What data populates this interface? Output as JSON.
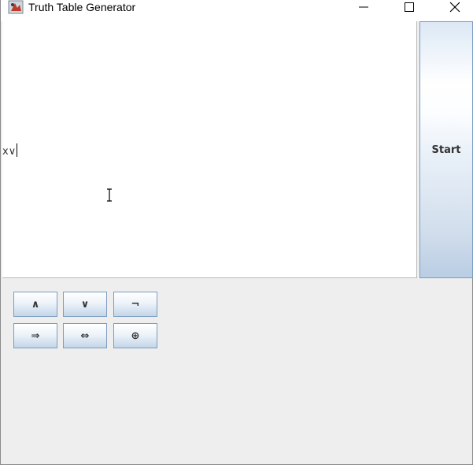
{
  "window": {
    "title": "Truth Table Generator",
    "icons": {
      "app": "java-app-icon",
      "minimize": "minimize-icon",
      "maximize": "maximize-icon",
      "close": "close-icon"
    }
  },
  "editor": {
    "text": "x∨",
    "cursor": "text-ibeam-cursor-icon"
  },
  "start_button": {
    "label": "Start"
  },
  "operators": {
    "and": "∧",
    "or": "∨",
    "not": "¬",
    "implies": "⇒",
    "iff": "⇔",
    "xor": "⊕"
  },
  "colors": {
    "button_border": "#7a9cc0",
    "panel_background": "#eeeeee",
    "editor_background": "#ffffff"
  }
}
